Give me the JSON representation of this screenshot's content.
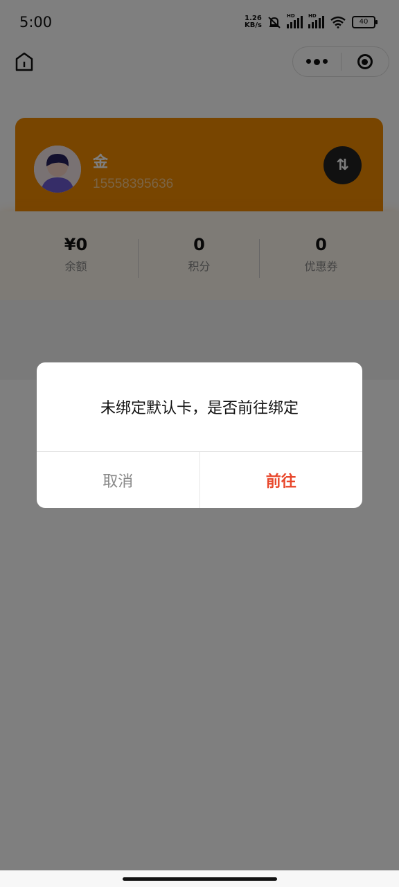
{
  "status_bar": {
    "time": "5:00",
    "net_speed_value": "1.26",
    "net_speed_unit": "KB/s",
    "hd_label": "HD",
    "battery": "40"
  },
  "card": {
    "user_name": "金",
    "phone": "15558395636",
    "switch_icon": "⇅",
    "brand_color": "#f08a00"
  },
  "stats": [
    {
      "value": "¥0",
      "label": "余额"
    },
    {
      "value": "0",
      "label": "积分"
    },
    {
      "value": "0",
      "label": "优惠券"
    }
  ],
  "dialog": {
    "message": "未绑定默认卡，是否前往绑定",
    "cancel_label": "取消",
    "confirm_label": "前往",
    "confirm_color": "#e8472b"
  }
}
